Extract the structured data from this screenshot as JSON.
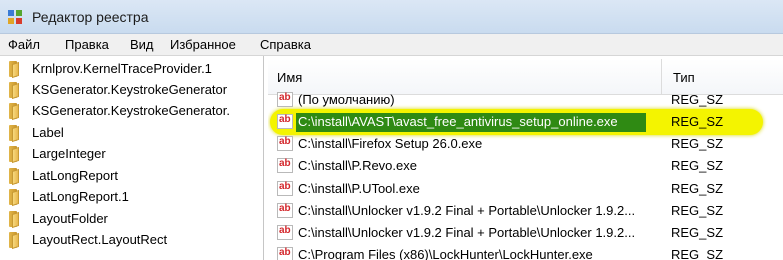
{
  "window": {
    "title": "Редактор реестра"
  },
  "menu": [
    "Файл",
    "Правка",
    "Вид",
    "Избранное",
    "Справка"
  ],
  "tree": {
    "items": [
      "Krnlprov.KernelTraceProvider.1",
      "KSGenerator.KeystrokeGenerator",
      "KSGenerator.KeystrokeGenerator.",
      "Label",
      "LargeInteger",
      "LatLongReport",
      "LatLongReport.1",
      "LayoutFolder",
      "LayoutRect.LayoutRect"
    ]
  },
  "list": {
    "columns": {
      "name": "Имя",
      "type": "Тип"
    },
    "rows": [
      {
        "name": "(По умолчанию)",
        "type": "REG_SZ"
      },
      {
        "name": "C:\\install\\AVAST\\avast_free_antivirus_setup_online.exe",
        "type": "REG_SZ"
      },
      {
        "name": "C:\\install\\Firefox Setup 26.0.exe",
        "type": "REG_SZ"
      },
      {
        "name": "C:\\install\\P.Revo.exe",
        "type": "REG_SZ"
      },
      {
        "name": "C:\\install\\P.UTool.exe",
        "type": "REG_SZ"
      },
      {
        "name": "C:\\install\\Unlocker v1.9.2 Final + Portable\\Unlocker 1.9.2...",
        "type": "REG_SZ"
      },
      {
        "name": "C:\\install\\Unlocker v1.9.2 Final + Portable\\Unlocker 1.9.2...",
        "type": "REG_SZ"
      },
      {
        "name": "C:\\Program Files (x86)\\LockHunter\\LockHunter.exe",
        "type": "REG_SZ"
      }
    ],
    "icon_text": "ab"
  },
  "colors": {
    "highlight": "#f4f400",
    "selection": "#2f8a13",
    "ab_icon": "#d3262b"
  }
}
